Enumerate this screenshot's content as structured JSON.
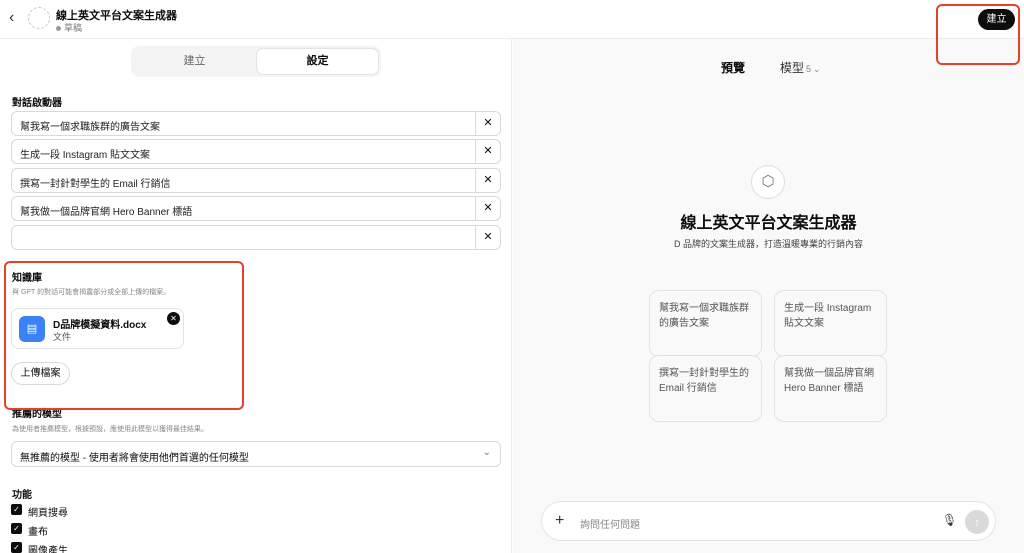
{
  "header": {
    "title": "線上英文平台文案生成器",
    "status": "草稿",
    "create_label": "建立"
  },
  "tabs": {
    "create": "建立",
    "configure": "設定"
  },
  "starters": {
    "label": "對話啟動器",
    "items": [
      "幫我寫一個求職族群的廣告文案",
      "生成一段 Instagram 貼文文案",
      "撰寫一封針對學生的 Email 行銷信",
      "幫我做一個品牌官網 Hero Banner 標語",
      ""
    ]
  },
  "knowledge": {
    "label": "知識庫",
    "helper": "與 GPT 的對話可能會揭露部分或全部上傳的檔案。",
    "file": {
      "name": "D品牌模擬資料.docx",
      "type": "文件"
    },
    "upload_label": "上傳檔案"
  },
  "model": {
    "label": "推薦的模型",
    "helper": "為使用者推薦模型，根據預設，應使用此模型以獲得最佳結果。",
    "selected": "無推薦的模型 - 使用者將會使用他們首選的任何模型"
  },
  "capabilities": {
    "label": "功能",
    "items": [
      {
        "label": "網頁搜尋",
        "checked": true
      },
      {
        "label": "畫布",
        "checked": true
      },
      {
        "label": "圖像產生",
        "checked": true
      }
    ]
  },
  "preview": {
    "tab_preview": "預覽",
    "tab_model": "模型",
    "model_version": "5",
    "title": "線上英文平台文案生成器",
    "description": "D 品牌的文案生成器，打造溫暖專業的行銷內容",
    "suggestions": [
      "幫我寫一個求職族群的廣告文案",
      "生成一段 Instagram 貼文文案",
      "撰寫一封針對學生的 Email 行銷信",
      "幫我做一個品牌官網 Hero Banner 標語"
    ],
    "composer_placeholder": "詢問任何問題"
  },
  "icons": {
    "back": "chevron-left-icon",
    "file": "document-icon",
    "remove": "close-icon",
    "avatar": "cube-icon",
    "mic": "microphone-icon",
    "send": "arrow-up-icon"
  },
  "colors": {
    "highlight": "#e0432c",
    "file_icon": "#3b82f6"
  }
}
